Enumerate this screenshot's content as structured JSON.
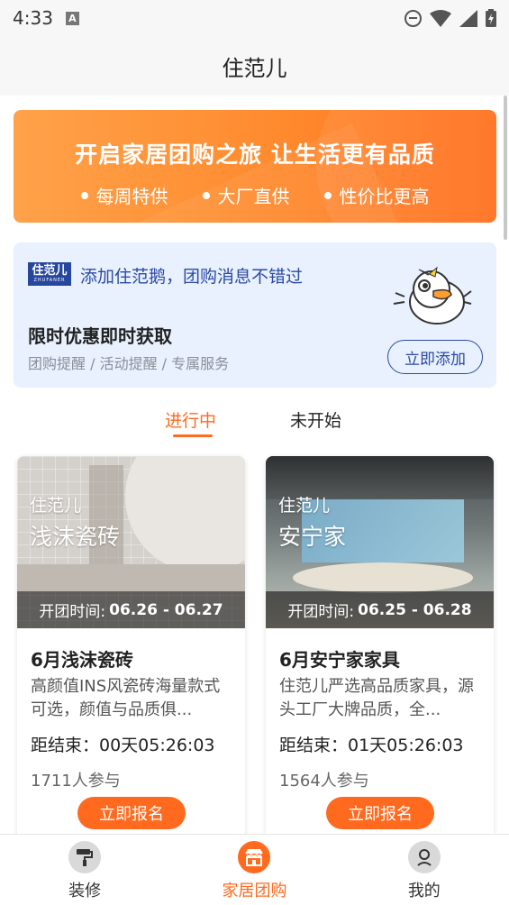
{
  "status_bar": {
    "time": "4:33",
    "notification_glyph": "A"
  },
  "header": {
    "title": "住范儿"
  },
  "banner": {
    "headline": "开启家居团购之旅 让生活更有品质",
    "points": [
      "每周特供",
      "大厂直供",
      "性价比更高"
    ]
  },
  "wechat_card": {
    "logo_text": "住范儿",
    "logo_subtext": "ZHUFANER",
    "title": "添加住范鹅，团购消息不错过",
    "promo_title": "限时优惠即时获取",
    "promo_sub": "团购提醒 / 活动提醒 / 专属服务",
    "add_label": "立即添加"
  },
  "tabs": [
    {
      "label": "进行中",
      "active": true
    },
    {
      "label": "未开始",
      "active": false
    }
  ],
  "cards": [
    {
      "brand": "住范儿",
      "subject": "浅沫瓷砖",
      "period_label": "开团时间:",
      "period_dates": "06.26 - 06.27",
      "title": "6月浅沫瓷砖",
      "description": "高颜值INS风瓷砖海量款式可选，颜值与品质俱...",
      "countdown": "距结束：00天05:26:03",
      "participants": "1711人参与",
      "signup_label": "立即报名"
    },
    {
      "brand": "住范儿",
      "subject": "安宁家",
      "period_label": "开团时间:",
      "period_dates": "06.25 - 06.28",
      "title": "6月安宁家家具",
      "description": "住范儿严选高品质家具，源头工厂大牌品质，全...",
      "countdown": "距结束：01天05:26:03",
      "participants": "1564人参与",
      "signup_label": "立即报名"
    }
  ],
  "bottom_nav": [
    {
      "label": "装修",
      "icon": "paint-roller-icon",
      "active": false
    },
    {
      "label": "家居团购",
      "icon": "shop-icon",
      "active": true
    },
    {
      "label": "我的",
      "icon": "user-icon",
      "active": false
    }
  ],
  "colors": {
    "accent": "#ff6a1f",
    "brand_blue": "#2b4aa5",
    "card_bg": "#e8f1fd"
  }
}
